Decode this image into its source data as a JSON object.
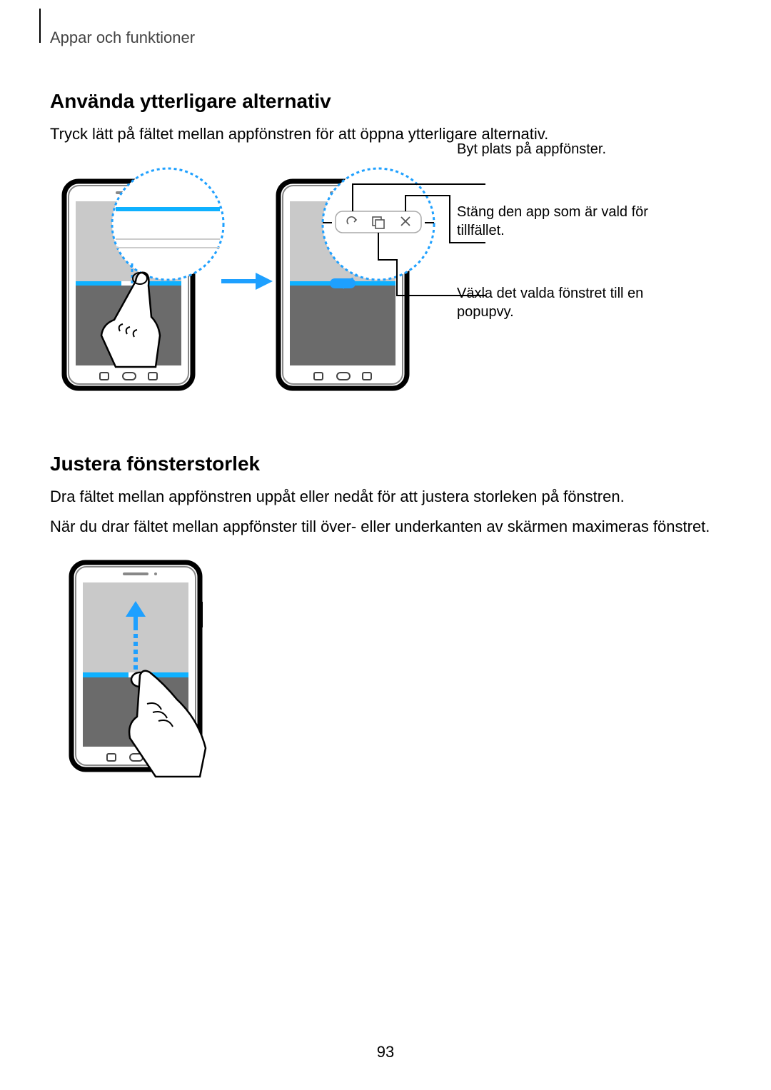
{
  "header": "Appar och funktioner",
  "section1": {
    "title": "Använda ytterligare alternativ",
    "body": "Tryck lätt på fältet mellan appfönstren för att öppna ytterligare alternativ."
  },
  "callouts": {
    "c1": "Byt plats på appfönster.",
    "c2": "Stäng den app som är vald för tillfället.",
    "c3": "Växla det valda fönstret till en popupvy."
  },
  "section2": {
    "title": "Justera fönsterstorlek",
    "body1": "Dra fältet mellan appfönstren uppåt eller nedåt för att justera storleken på fönstren.",
    "body2": "När du drar fältet mellan appfönster till över- eller underkanten av skärmen maximeras fönstret."
  },
  "pageNumber": "93"
}
